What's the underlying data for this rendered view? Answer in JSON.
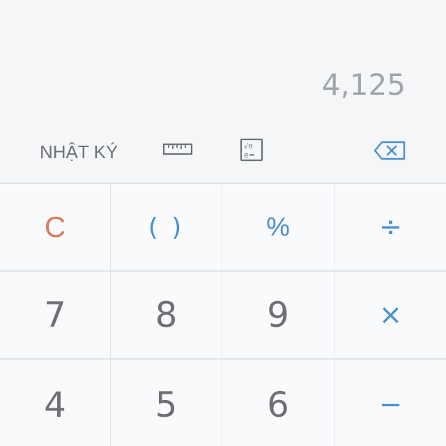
{
  "display": {
    "value": "4,125"
  },
  "toolbar": {
    "history_label": "NHẬT KÝ",
    "ruler_icon": "ruler-icon",
    "scientific_icon": "scientific-mode-icon",
    "backspace_icon": "backspace-icon"
  },
  "keys": {
    "clear": "C",
    "parentheses": "( )",
    "percent": "%",
    "divide": "÷",
    "seven": "7",
    "eight": "8",
    "nine": "9",
    "multiply": "×",
    "four": "4",
    "five": "5",
    "six": "6",
    "minus": "−"
  },
  "colors": {
    "background": "#f4f6f8",
    "key_background": "#f9fafb",
    "divider": "#dfe4e8",
    "digit": "#6e7073",
    "operator": "#4a8fcf",
    "clear": "#dc7a5c",
    "display_text": "#a3a6a9"
  }
}
